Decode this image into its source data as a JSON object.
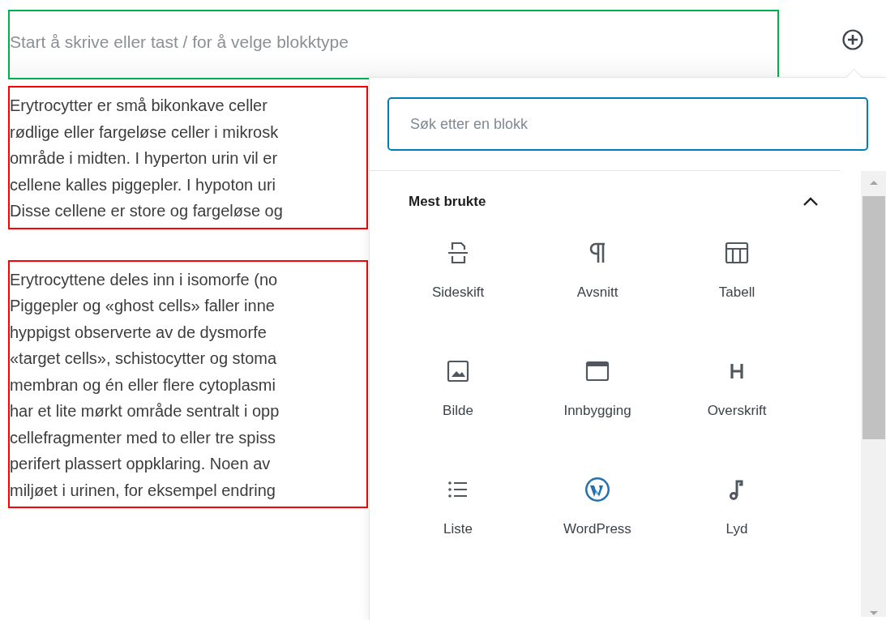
{
  "editor": {
    "placeholder": "Start å skrive eller tast / for å velge blokktype"
  },
  "paragraphs": [
    {
      "lines": [
        "Erytrocytter er små bikonkave celler",
        "rødlige eller fargeløse celler i mikrosk",
        "område i midten. I hyperton urin vil er",
        "cellene kalles piggepler. I hypoton uri",
        "Disse cellene er store og fargeløse og"
      ]
    },
    {
      "lines": [
        "Erytrocyttene deles inn i isomorfe (no",
        "Piggepler og «ghost cells» faller inne",
        "hyppigst observerte av de dysmorfe",
        "«target cells», schistocytter og stoma",
        "membran og én eller flere cytoplasmi",
        "har et lite mørkt område sentralt i opp",
        "cellefragmenter med to eller tre spiss",
        "perifert plassert oppklaring. Noen av",
        "miljøet i urinen, for eksempel endring"
      ]
    }
  ],
  "inserter": {
    "search": {
      "placeholder": "Søk etter en blokk"
    },
    "section": {
      "title": "Mest brukte",
      "expanded": true
    },
    "blocks": [
      {
        "label": "Sideskift",
        "kind": "pagebreak"
      },
      {
        "label": "Avsnitt",
        "kind": "paragraph"
      },
      {
        "label": "Tabell",
        "kind": "table"
      },
      {
        "label": "Bilde",
        "kind": "image"
      },
      {
        "label": "Innbygging",
        "kind": "embed"
      },
      {
        "label": "Overskrift",
        "kind": "heading"
      },
      {
        "label": "Liste",
        "kind": "list"
      },
      {
        "label": "WordPress",
        "kind": "wordpress"
      },
      {
        "label": "Lyd",
        "kind": "audio"
      }
    ]
  }
}
